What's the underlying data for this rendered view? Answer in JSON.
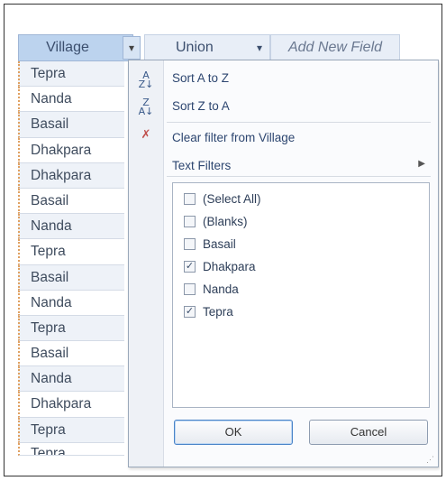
{
  "datasheet": {
    "columns": {
      "village": "Village",
      "union": "Union",
      "add_new_field": "Add New Field"
    },
    "dropdown_glyph": "▾",
    "rows": [
      "Tepra",
      "Nanda",
      "Basail",
      "Dhakpara",
      "Dhakpara",
      "Basail",
      "Nanda",
      "Tepra",
      "Basail",
      "Nanda",
      "Tepra",
      "Basail",
      "Nanda",
      "Dhakpara",
      "Tepra",
      "Tepra"
    ]
  },
  "filter_menu": {
    "sort_asc": "Sort A to Z",
    "sort_desc": "Sort Z to A",
    "clear_filter": "Clear filter from Village",
    "text_filters": "Text Filters",
    "icons": {
      "sort_asc": "sort-a-z-icon",
      "sort_desc": "sort-z-a-icon",
      "clear_filter": "clear-filter-icon",
      "submenu": "chevron-right-icon"
    },
    "values": [
      {
        "label": "(Select All)",
        "checked": false
      },
      {
        "label": "(Blanks)",
        "checked": false
      },
      {
        "label": "Basail",
        "checked": false
      },
      {
        "label": "Dhakpara",
        "checked": true
      },
      {
        "label": "Nanda",
        "checked": false
      },
      {
        "label": "Tepra",
        "checked": true
      }
    ],
    "ok": "OK",
    "cancel": "Cancel"
  },
  "colors": {
    "header_active": "#bcd3ee",
    "menu_text": "#2d4670",
    "ok_border": "#4a84c8"
  }
}
